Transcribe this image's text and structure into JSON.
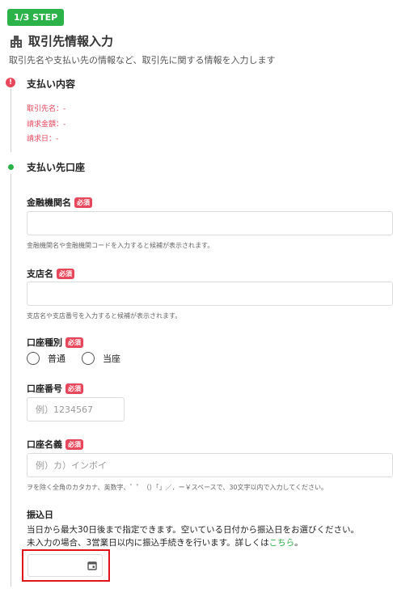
{
  "step_badge": "1/3 STEP",
  "page": {
    "title": "取引先情報入力",
    "description": "取引先名や支払い先の情報など、取引先に関する情報を入力します"
  },
  "payment_content": {
    "title": "支払い内容",
    "lines": [
      "取引先名：-",
      "請求金額：-",
      "請求日：-"
    ]
  },
  "account": {
    "title": "支払い先口座",
    "required_badge": "必須",
    "bank_name": {
      "label": "金融機関名",
      "value": "",
      "hint": "金融機関名や金融機関コードを入力すると候補が表示されます。"
    },
    "branch_name": {
      "label": "支店名",
      "value": "",
      "hint": "支店名や支店番号を入力すると候補が表示されます。"
    },
    "account_type": {
      "label": "口座種別",
      "options": [
        "普通",
        "当座"
      ]
    },
    "account_number": {
      "label": "口座番号",
      "placeholder": "例）1234567"
    },
    "account_holder": {
      "label": "口座名義",
      "placeholder": "例）カ）インボイ",
      "hint": "ヲを除く全角のカタカナ、英数字、゛゜（）「」／．ー￥スペースで、30文字以内で入力してください。"
    },
    "transfer_date": {
      "label": "振込日",
      "desc_line1": "当日から最大30日後まで指定できます。空いている日付から振込日をお選びください。",
      "desc_line2": "未入力の場合、3営業日以内に振込手続きを行います。詳しくは",
      "link": "こちら",
      "after_link": "。"
    }
  },
  "colors": {
    "accent": "#2bb34a",
    "required": "#e8465b",
    "highlight": "#e0141b"
  },
  "icons": [
    "building-icon",
    "alert-icon",
    "calendar-icon"
  ]
}
